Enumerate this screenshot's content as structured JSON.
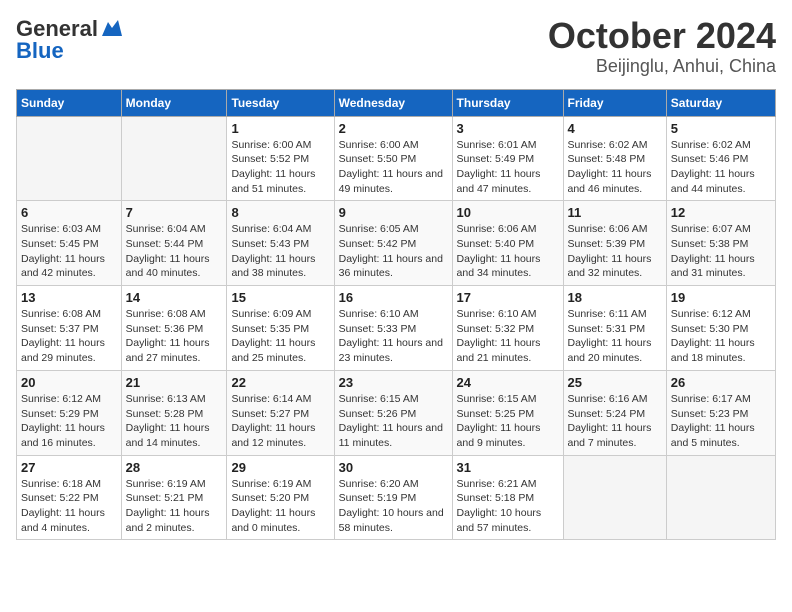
{
  "logo": {
    "line1": "General",
    "line2": "Blue"
  },
  "title": "October 2024",
  "subtitle": "Beijinglu, Anhui, China",
  "days_of_week": [
    "Sunday",
    "Monday",
    "Tuesday",
    "Wednesday",
    "Thursday",
    "Friday",
    "Saturday"
  ],
  "weeks": [
    [
      {
        "day": "",
        "info": ""
      },
      {
        "day": "",
        "info": ""
      },
      {
        "day": "1",
        "info": "Sunrise: 6:00 AM\nSunset: 5:52 PM\nDaylight: 11 hours and 51 minutes."
      },
      {
        "day": "2",
        "info": "Sunrise: 6:00 AM\nSunset: 5:50 PM\nDaylight: 11 hours and 49 minutes."
      },
      {
        "day": "3",
        "info": "Sunrise: 6:01 AM\nSunset: 5:49 PM\nDaylight: 11 hours and 47 minutes."
      },
      {
        "day": "4",
        "info": "Sunrise: 6:02 AM\nSunset: 5:48 PM\nDaylight: 11 hours and 46 minutes."
      },
      {
        "day": "5",
        "info": "Sunrise: 6:02 AM\nSunset: 5:46 PM\nDaylight: 11 hours and 44 minutes."
      }
    ],
    [
      {
        "day": "6",
        "info": "Sunrise: 6:03 AM\nSunset: 5:45 PM\nDaylight: 11 hours and 42 minutes."
      },
      {
        "day": "7",
        "info": "Sunrise: 6:04 AM\nSunset: 5:44 PM\nDaylight: 11 hours and 40 minutes."
      },
      {
        "day": "8",
        "info": "Sunrise: 6:04 AM\nSunset: 5:43 PM\nDaylight: 11 hours and 38 minutes."
      },
      {
        "day": "9",
        "info": "Sunrise: 6:05 AM\nSunset: 5:42 PM\nDaylight: 11 hours and 36 minutes."
      },
      {
        "day": "10",
        "info": "Sunrise: 6:06 AM\nSunset: 5:40 PM\nDaylight: 11 hours and 34 minutes."
      },
      {
        "day": "11",
        "info": "Sunrise: 6:06 AM\nSunset: 5:39 PM\nDaylight: 11 hours and 32 minutes."
      },
      {
        "day": "12",
        "info": "Sunrise: 6:07 AM\nSunset: 5:38 PM\nDaylight: 11 hours and 31 minutes."
      }
    ],
    [
      {
        "day": "13",
        "info": "Sunrise: 6:08 AM\nSunset: 5:37 PM\nDaylight: 11 hours and 29 minutes."
      },
      {
        "day": "14",
        "info": "Sunrise: 6:08 AM\nSunset: 5:36 PM\nDaylight: 11 hours and 27 minutes."
      },
      {
        "day": "15",
        "info": "Sunrise: 6:09 AM\nSunset: 5:35 PM\nDaylight: 11 hours and 25 minutes."
      },
      {
        "day": "16",
        "info": "Sunrise: 6:10 AM\nSunset: 5:33 PM\nDaylight: 11 hours and 23 minutes."
      },
      {
        "day": "17",
        "info": "Sunrise: 6:10 AM\nSunset: 5:32 PM\nDaylight: 11 hours and 21 minutes."
      },
      {
        "day": "18",
        "info": "Sunrise: 6:11 AM\nSunset: 5:31 PM\nDaylight: 11 hours and 20 minutes."
      },
      {
        "day": "19",
        "info": "Sunrise: 6:12 AM\nSunset: 5:30 PM\nDaylight: 11 hours and 18 minutes."
      }
    ],
    [
      {
        "day": "20",
        "info": "Sunrise: 6:12 AM\nSunset: 5:29 PM\nDaylight: 11 hours and 16 minutes."
      },
      {
        "day": "21",
        "info": "Sunrise: 6:13 AM\nSunset: 5:28 PM\nDaylight: 11 hours and 14 minutes."
      },
      {
        "day": "22",
        "info": "Sunrise: 6:14 AM\nSunset: 5:27 PM\nDaylight: 11 hours and 12 minutes."
      },
      {
        "day": "23",
        "info": "Sunrise: 6:15 AM\nSunset: 5:26 PM\nDaylight: 11 hours and 11 minutes."
      },
      {
        "day": "24",
        "info": "Sunrise: 6:15 AM\nSunset: 5:25 PM\nDaylight: 11 hours and 9 minutes."
      },
      {
        "day": "25",
        "info": "Sunrise: 6:16 AM\nSunset: 5:24 PM\nDaylight: 11 hours and 7 minutes."
      },
      {
        "day": "26",
        "info": "Sunrise: 6:17 AM\nSunset: 5:23 PM\nDaylight: 11 hours and 5 minutes."
      }
    ],
    [
      {
        "day": "27",
        "info": "Sunrise: 6:18 AM\nSunset: 5:22 PM\nDaylight: 11 hours and 4 minutes."
      },
      {
        "day": "28",
        "info": "Sunrise: 6:19 AM\nSunset: 5:21 PM\nDaylight: 11 hours and 2 minutes."
      },
      {
        "day": "29",
        "info": "Sunrise: 6:19 AM\nSunset: 5:20 PM\nDaylight: 11 hours and 0 minutes."
      },
      {
        "day": "30",
        "info": "Sunrise: 6:20 AM\nSunset: 5:19 PM\nDaylight: 10 hours and 58 minutes."
      },
      {
        "day": "31",
        "info": "Sunrise: 6:21 AM\nSunset: 5:18 PM\nDaylight: 10 hours and 57 minutes."
      },
      {
        "day": "",
        "info": ""
      },
      {
        "day": "",
        "info": ""
      }
    ]
  ]
}
